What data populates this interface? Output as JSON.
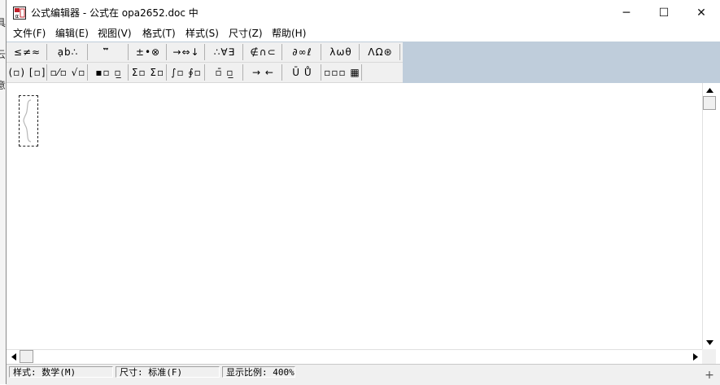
{
  "behind_window": {
    "glyphs": [
      "具",
      "云",
      "意"
    ]
  },
  "window": {
    "title": "公式编辑器 - 公式在 opa2652.doc 中",
    "controls": {
      "minimize": "─",
      "maximize": "☐",
      "close": "✕"
    }
  },
  "menu": [
    {
      "label": "文件(F)"
    },
    {
      "label": "编辑(E)"
    },
    {
      "label": "视图(V)"
    },
    {
      "label": "格式(T)"
    },
    {
      "label": "样式(S)"
    },
    {
      "label": "尺寸(Z)"
    },
    {
      "label": "帮助(H)"
    }
  ],
  "toolbar": {
    "row1": [
      {
        "label": "≤≠≈",
        "name": "relational-symbols-palette"
      },
      {
        "label": "ạb∴",
        "name": "spaces-ellipses-palette"
      },
      {
        "label": "⃗⃡⃛",
        "name": "embellishments-palette"
      },
      {
        "label": "±•⊗",
        "name": "operator-symbols-palette"
      },
      {
        "label": "→⇔↓",
        "name": "arrow-symbols-palette"
      },
      {
        "label": "∴∀∃",
        "name": "logical-symbols-palette"
      },
      {
        "label": "∉∩⊂",
        "name": "set-theory-symbols-palette"
      },
      {
        "label": "∂∞ℓ",
        "name": "misc-symbols-palette"
      },
      {
        "label": "λωθ",
        "name": "greek-lowercase-palette"
      },
      {
        "label": "ΛΩ⊛",
        "name": "greek-uppercase-palette"
      }
    ],
    "row2": [
      {
        "label": "(▫) [▫]",
        "name": "fence-templates-palette"
      },
      {
        "label": "▫⁄▫ √▫",
        "name": "fraction-radical-templates-palette"
      },
      {
        "label": "▪▫ ▫̲",
        "name": "subscript-superscript-templates-palette"
      },
      {
        "label": "Σ▫ Σ▫",
        "name": "summation-templates-palette"
      },
      {
        "label": "∫▫ ∮▫",
        "name": "integral-templates-palette"
      },
      {
        "label": "▫̄ ▫̲",
        "name": "underbar-overbar-templates-palette"
      },
      {
        "label": "→ ←",
        "name": "labeled-arrow-templates-palette"
      },
      {
        "label": "Ū Ů",
        "name": "products-set-theory-templates-palette"
      },
      {
        "label": "▫▫▫ ▦",
        "name": "matrix-templates-palette"
      }
    ]
  },
  "status": {
    "style": "样式: 数学(M)",
    "size": "尺寸: 标准(F)",
    "zoom": "显示比例: 400%"
  },
  "colors": {
    "toolbar_background": "#bfcddb",
    "palette_background": "#f0f0f0",
    "window_background": "#ffffff"
  }
}
